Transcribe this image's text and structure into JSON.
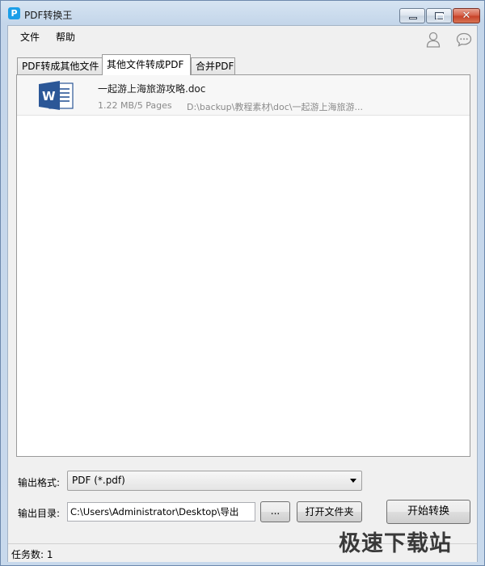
{
  "window": {
    "title": "PDF转换王",
    "app_icon": "P",
    "close_glyph": "✕"
  },
  "menu": {
    "file": "文件",
    "help": "帮助"
  },
  "icons": {
    "user": "user-icon",
    "chat": "chat-bubble-icon"
  },
  "tabs": [
    {
      "label": "PDF转成其他文件",
      "active": false
    },
    {
      "label": "其他文件转成PDF",
      "active": true
    },
    {
      "label": "合并PDF",
      "active": false
    }
  ],
  "files": [
    {
      "name": "一起游上海旅游攻略.doc",
      "size_pages": "1.22 MB/5 Pages",
      "path": "D:\\backup\\教程素材\\doc\\一起游上海旅游..."
    }
  ],
  "output": {
    "format_label": "输出格式:",
    "format_value": "PDF (*.pdf)",
    "dir_label": "输出目录:",
    "dir_value": "C:\\Users\\Administrator\\Desktop\\导出"
  },
  "buttons": {
    "browse": "...",
    "open_folder": "打开文件夹",
    "start": "开始转换"
  },
  "status": {
    "task_count": "任务数: 1"
  },
  "watermark": "极速下载站",
  "colors": {
    "word_blue": "#2b5797",
    "app_icon_blue": "#1a9ee8",
    "close_red": "#c8432a"
  }
}
